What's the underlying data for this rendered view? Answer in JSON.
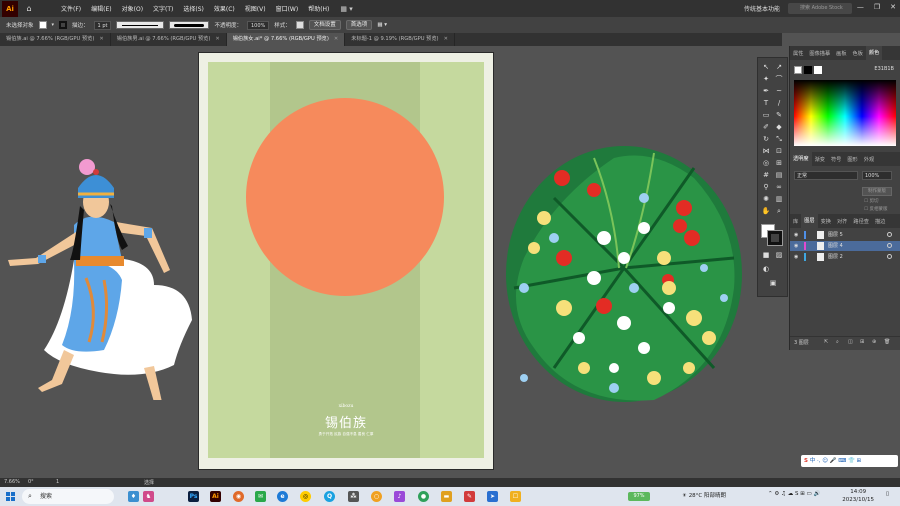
{
  "menubar": {
    "logo": "Ai",
    "items": [
      "文件(F)",
      "编辑(E)",
      "对象(O)",
      "文字(T)",
      "选择(S)",
      "效果(C)",
      "视图(V)",
      "窗口(W)",
      "帮助(H)"
    ],
    "workspace": "传统基本功能",
    "search_placeholder": "搜索 Adobe Stock"
  },
  "controlbar": {
    "selection": "未选择对象",
    "stroke_label": "描边：",
    "stroke_weight": "1 pt",
    "brush_label": "基本",
    "opacity_label": "不透明度：",
    "opacity_value": "100%",
    "style_label": "样式：",
    "doc_setup": "文档设置",
    "prefs": "首选项"
  },
  "tabs": [
    {
      "label": "锡伯族.ai @ 7.66% (RGB/GPU 预览)",
      "active": false
    },
    {
      "label": "锡伯族男.ai @ 7.66% (RGB/GPU 预览)",
      "active": false
    },
    {
      "label": "锡伯族女.ai* @ 7.66% (RGB/GPU 预览)",
      "active": true
    },
    {
      "label": "未标题-1 @ 9.19% (RGB/GPU 预览)",
      "active": false
    }
  ],
  "poster": {
    "pinyin": "xibozu",
    "title": "锡伯族",
    "subtitle": "勇于开拓 民族 自强不息 善良 仁厚",
    "colors": {
      "bg": "#c5d99e",
      "band": "#b2c68c",
      "sun": "#f68a5c"
    }
  },
  "color_panel": {
    "tabs": [
      "属性",
      "图像描摹",
      "画板",
      "色板",
      "颜色"
    ],
    "hex": "E31B1B"
  },
  "transparency_panel": {
    "tabs": [
      "透明度",
      "渐变",
      "符号",
      "图形",
      "外观"
    ],
    "blend_mode": "正常",
    "opacity_label": "不透明度：",
    "opacity": "100%",
    "make_mask": "制作蒙版",
    "clip": "剪切",
    "invert": "反相蒙版"
  },
  "layers_panel": {
    "tabs": [
      "库",
      "图层",
      "变换",
      "对齐",
      "路径查",
      "描边"
    ],
    "layers": [
      {
        "name": "图层 5",
        "color": "#4f8fe6",
        "selected": false
      },
      {
        "name": "图层 4",
        "color": "#e04ad0",
        "selected": true
      },
      {
        "name": "图层 2",
        "color": "#3fa7e0",
        "selected": false
      }
    ],
    "count": "3 图层"
  },
  "status": {
    "zoom": "7.66%",
    "rotation": "0°",
    "page": "1",
    "tool": "选择"
  },
  "taskbar": {
    "search": "搜索",
    "battery": "97%",
    "weather": "28°C 阳部晴朗",
    "time": "14:09",
    "date": "2023/10/15",
    "ime": "中"
  }
}
